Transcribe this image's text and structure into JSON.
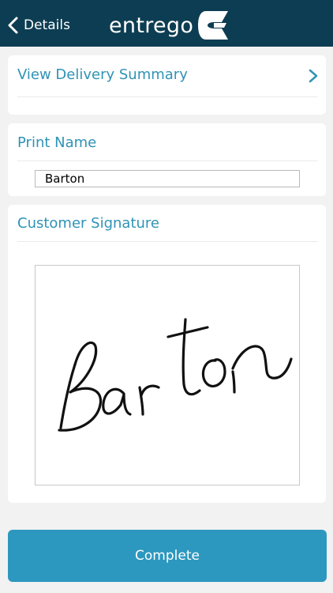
{
  "header": {
    "back_label": "Details",
    "brand_name": "entrego",
    "back_icon": "chevron-left-icon",
    "logo_icon": "entrego-logo-icon"
  },
  "delivery_summary": {
    "label": "View Delivery Summary",
    "icon": "chevron-right-icon"
  },
  "print_name": {
    "title": "Print Name",
    "value": "Barton"
  },
  "signature": {
    "title": "Customer Signature",
    "signed_name": "Barton"
  },
  "footer": {
    "complete_label": "Complete"
  },
  "colors": {
    "header_bg": "#0d3d52",
    "accent": "#2f93b5",
    "button_bg": "#2d98bf",
    "page_bg": "#f2f2f2"
  }
}
